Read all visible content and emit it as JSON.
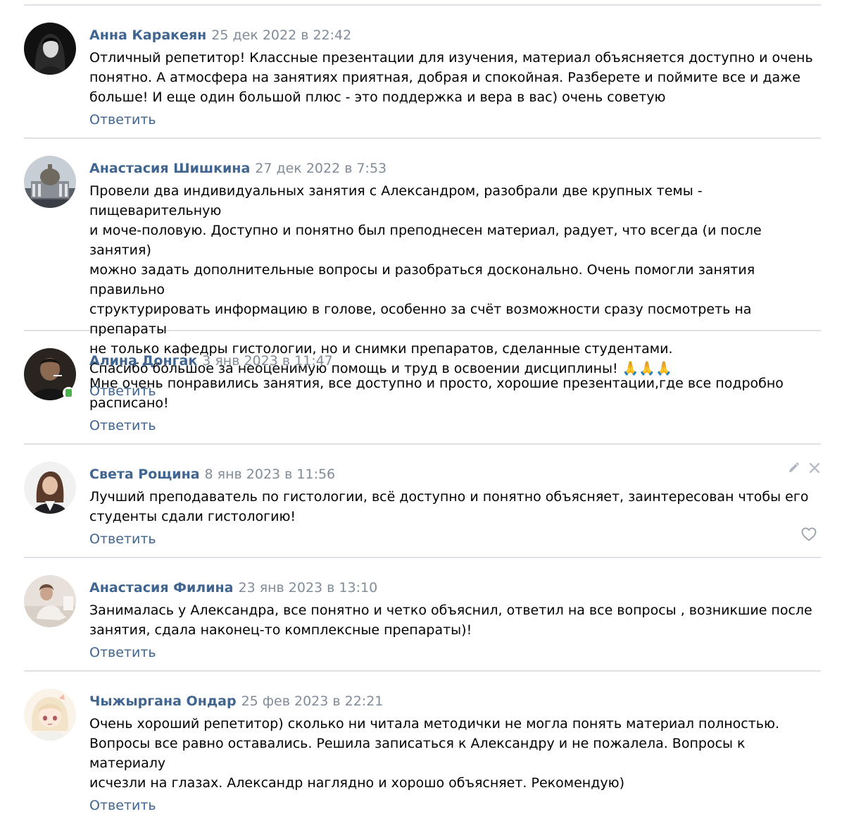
{
  "reply_label": "Ответить",
  "colors": {
    "author": "#3f6590",
    "date": "#818c99",
    "reply": "#3f6590",
    "separator": "#dfe1e4",
    "online": "#4bb34b"
  },
  "comments": [
    {
      "author": "Анна Каракеян",
      "date": "25 дек 2022 в 22:42",
      "text": "Отличный репетитор! Классные презентации для изучения, материал объясняется доступно и очень\nпонятно. А атмосфера на занятиях приятная, добрая и спокойная. Разберете и поймите все и даже\nбольше! И еще один большой плюс - это поддержка и вера в вас) очень советую"
    },
    {
      "author": "Анастасия Шишкина",
      "date": "27 дек 2022 в 7:53",
      "text": "Провели два индивидуальных занятия с Александром, разобрали две крупных темы - пищеварительную\nи моче-половую. Доступно и понятно был преподнесен материал, радует, что всегда (и после занятия)\nможно задать дополнительные вопросы и разобраться досконально. Очень помогли занятия правильно\nструктурировать информацию в голове, особенно за счёт возможности сразу посмотреть на препараты\nне только кафедры гистологии, но и снимки препаратов, сделанные студентами.\nСпасибо большое за неоценимую помощь и труд в освоении дисциплины! 🙏🙏🙏"
    },
    {
      "author": "Алина Донгак",
      "date": "3 янв 2023 в 11:47",
      "text": "Мне очень понравились занятия, все доступно и просто, хорошие презентации,где все подробно\nрасписано!",
      "online_icon": "mobile-online-icon"
    },
    {
      "author": "Света Рощина",
      "date": "8 янв 2023 в 11:56",
      "text": "Лучший преподаватель по гистологии, всё доступно и понятно объясняет, заинтересован чтобы его\nстуденты сдали гистологию!",
      "tools": [
        "edit-icon",
        "close-icon"
      ],
      "like_icon": "heart-icon"
    },
    {
      "author": "Анастасия Филина",
      "date": "23 янв 2023 в 13:10",
      "text": "Занималась у Александра, все понятно и четко объяснил, ответил на все вопросы , возникшие после\nзанятия, сдала наконец-то комплексные препараты)!"
    },
    {
      "author": "Чыжыргана Ондар",
      "date": "25 фев 2023 в 22:21",
      "text": "Очень хороший репетитор) сколько ни читала методички не могла понять материал полностью.\nВопросы все равно оставались. Решила записаться к Александру и не пожалела. Вопросы к материалу\nисчезли на глазах. Александр наглядно и хорошо объясняет. Рекомендую)"
    }
  ]
}
